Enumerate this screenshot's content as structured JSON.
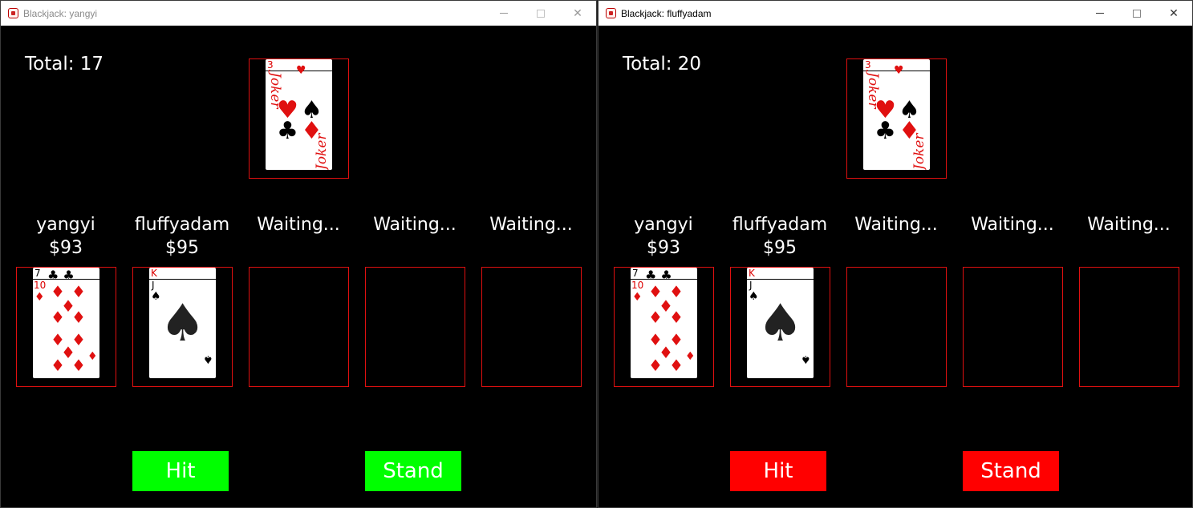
{
  "windows": [
    {
      "title": "Blackjack: yangyi",
      "total": "Total: 17",
      "dealer_card": {
        "rank": "3",
        "name": "Joker"
      },
      "players": [
        {
          "name": "yangyi",
          "money": "$93",
          "card": {
            "rank": "7",
            "sub": "10",
            "suit": "diamonds"
          }
        },
        {
          "name": "fluffyadam",
          "money": "$95",
          "card": {
            "rank": "K",
            "sub": "J",
            "suit": "spades"
          }
        },
        {
          "name": "Waiting...",
          "money": ""
        },
        {
          "name": "Waiting...",
          "money": ""
        },
        {
          "name": "Waiting...",
          "money": ""
        }
      ],
      "buttons": {
        "hit": "Hit",
        "stand": "Stand",
        "color": "#00ff00"
      }
    },
    {
      "title": "Blackjack: fluffyadam",
      "total": "Total: 20",
      "dealer_card": {
        "rank": "3",
        "name": "Joker"
      },
      "players": [
        {
          "name": "yangyi",
          "money": "$93",
          "card": {
            "rank": "7",
            "sub": "10",
            "suit": "diamonds"
          }
        },
        {
          "name": "fluffyadam",
          "money": "$95",
          "card": {
            "rank": "K",
            "sub": "J",
            "suit": "spades"
          }
        },
        {
          "name": "Waiting...",
          "money": ""
        },
        {
          "name": "Waiting...",
          "money": ""
        },
        {
          "name": "Waiting...",
          "money": ""
        }
      ],
      "buttons": {
        "hit": "Hit",
        "stand": "Stand",
        "color": "#ff0000"
      }
    }
  ],
  "colors": {
    "slot_border": "#e01010",
    "table_bg": "#000000"
  },
  "icons": {
    "app": "card-icon",
    "minimize": "minimize-icon",
    "maximize": "maximize-icon",
    "close": "close-icon"
  }
}
